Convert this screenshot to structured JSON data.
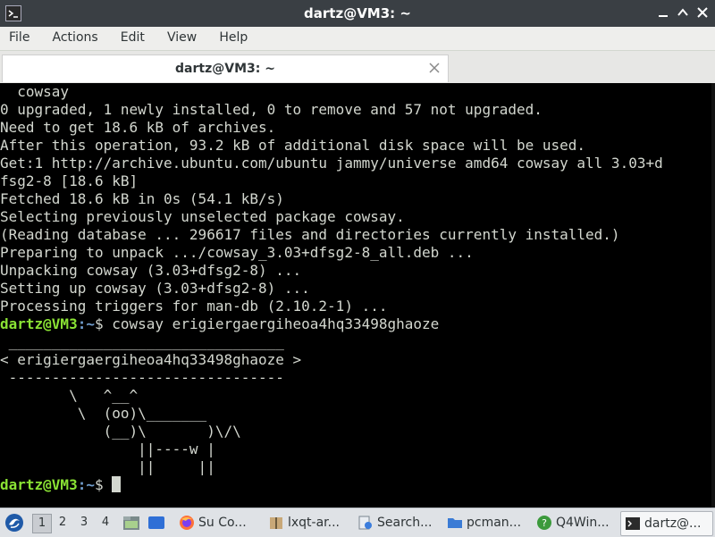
{
  "window": {
    "title": "dartz@VM3: ~",
    "icons": {
      "app": "terminal-icon",
      "minimize": "minimize-icon",
      "maximize": "maximize-icon",
      "close": "close-icon"
    }
  },
  "menubar": {
    "items": [
      {
        "label": "File"
      },
      {
        "label": "Actions"
      },
      {
        "label": "Edit"
      },
      {
        "label": "View"
      },
      {
        "label": "Help"
      }
    ]
  },
  "tabs": [
    {
      "label": "dartz@VM3: ~",
      "active": true
    }
  ],
  "terminal": {
    "lines": [
      "  cowsay",
      "0 upgraded, 1 newly installed, 0 to remove and 57 not upgraded.",
      "Need to get 18.6 kB of archives.",
      "After this operation, 93.2 kB of additional disk space will be used.",
      "Get:1 http://archive.ubuntu.com/ubuntu jammy/universe amd64 cowsay all 3.03+d",
      "fsg2-8 [18.6 kB]",
      "Fetched 18.6 kB in 0s (54.1 kB/s)",
      "Selecting previously unselected package cowsay.",
      "(Reading database ... 296617 files and directories currently installed.)",
      "Preparing to unpack .../cowsay_3.03+dfsg2-8_all.deb ...",
      "Unpacking cowsay (3.03+dfsg2-8) ...",
      "Setting up cowsay (3.03+dfsg2-8) ...",
      "Processing triggers for man-db (2.10.2-1) ..."
    ],
    "prompt_user": "dartz@VM3",
    "prompt_sep": ":",
    "prompt_path": "~",
    "prompt_symbol": "$ ",
    "command": "cowsay erigiergaergiheoa4hq33498ghaoze",
    "output": [
      " ________________________________",
      "< erigiergaergiheoa4hq33498ghaoze >",
      " --------------------------------",
      "        \\   ^__^",
      "         \\  (oo)\\_______",
      "            (__)\\       )\\/\\",
      "                ||----w |",
      "                ||     ||"
    ],
    "colors": {
      "user": "#8ae234",
      "path": "#729fcf",
      "text": "#d3d7cf",
      "background": "#000000"
    }
  },
  "taskbar": {
    "desktops": [
      "1",
      "2",
      "3",
      "4"
    ],
    "active_desktop": "1",
    "tasks": [
      {
        "label": "Su Co...",
        "icon": "firefox-icon"
      },
      {
        "label": "lxqt-ar...",
        "icon": "archive-icon"
      },
      {
        "label": "Search...",
        "icon": "search-files-icon"
      },
      {
        "label": "pcman...",
        "icon": "folder-icon"
      },
      {
        "label": "Q4Win...",
        "icon": "q4wine-icon"
      },
      {
        "label": "dartz@...",
        "icon": "terminal-icon",
        "active": true
      }
    ]
  }
}
